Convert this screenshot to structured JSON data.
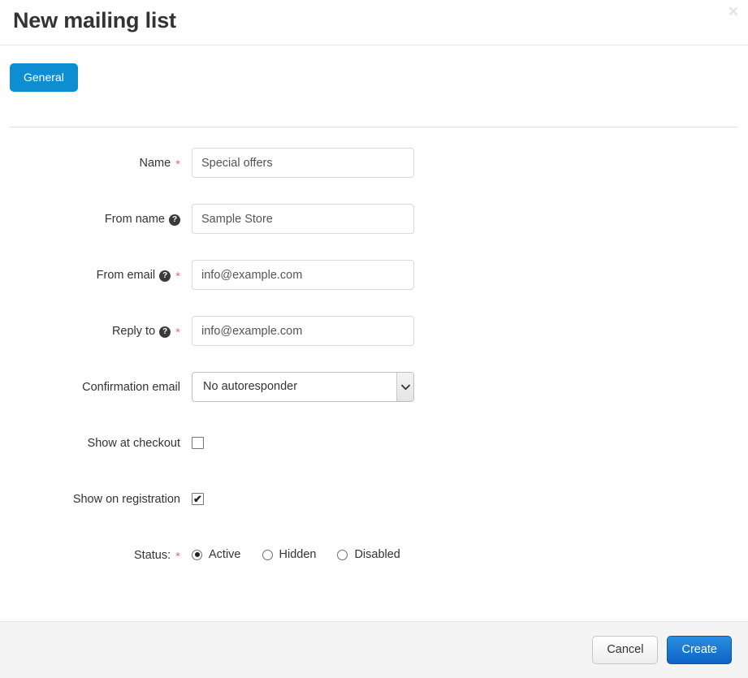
{
  "dialog": {
    "title": "New mailing list",
    "close_icon": "close-icon",
    "close_glyph": "✕"
  },
  "tabs": [
    {
      "label": "General",
      "active": true
    }
  ],
  "form": {
    "rows": [
      {
        "label": "Name",
        "required": true,
        "help": false,
        "type": "text",
        "value": "Special offers"
      },
      {
        "label": "From name",
        "required": false,
        "help": true,
        "type": "text",
        "value": "Sample Store"
      },
      {
        "label": "From email",
        "required": true,
        "help": true,
        "type": "text",
        "value": "info@example.com"
      },
      {
        "label": "Reply to",
        "required": true,
        "help": true,
        "type": "text",
        "value": "info@example.com"
      },
      {
        "label": "Confirmation email",
        "required": false,
        "help": false,
        "type": "select",
        "value": "No autoresponder"
      },
      {
        "label": "Show at checkout",
        "required": false,
        "help": false,
        "type": "checkbox",
        "checked": false
      },
      {
        "label": "Show on registration",
        "required": false,
        "help": false,
        "type": "checkbox",
        "checked": true
      },
      {
        "label": "Status:",
        "required": true,
        "help": false,
        "type": "radio",
        "options": [
          "Active",
          "Hidden",
          "Disabled"
        ],
        "selected": "Active"
      }
    ],
    "help_glyph": "?",
    "required_glyph": "*",
    "check_glyph": "✔"
  },
  "footer": {
    "cancel_label": "Cancel",
    "create_label": "Create"
  },
  "colors": {
    "accent": "#0e8ed0",
    "primary_button": "#1173cf",
    "required": "#f06c6c",
    "footer_bg": "#f4f4f4"
  }
}
